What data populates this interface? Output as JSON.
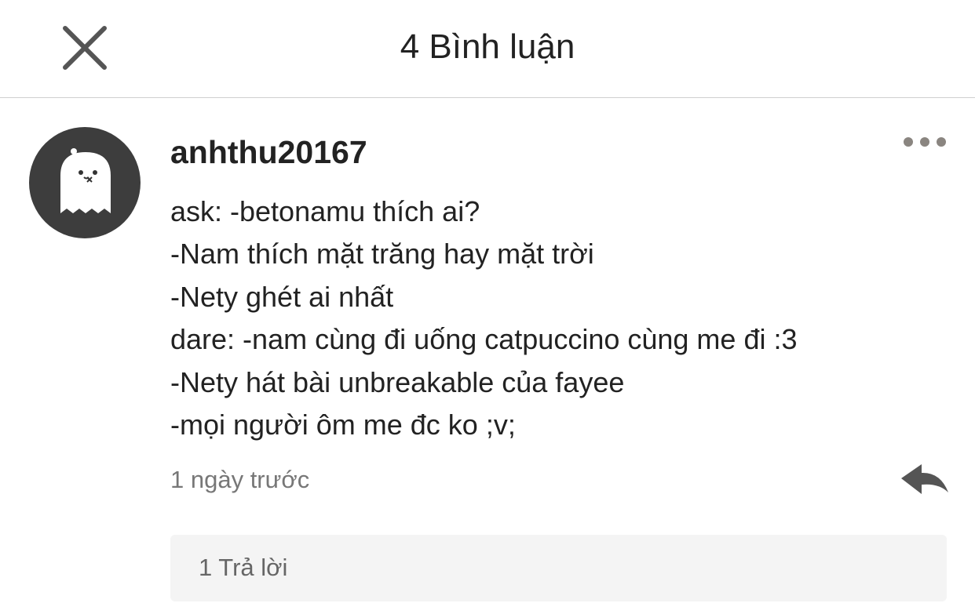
{
  "header": {
    "title": "4 Bình luận",
    "close_icon": "close-icon"
  },
  "comment": {
    "avatar_icon": "ghost-avatar",
    "username": "anhthu20167",
    "more_icon": "more-horizontal-icon",
    "lines": [
      "ask: -betonamu thích ai?",
      "-Nam thích mặt trăng hay mặt trời",
      "-Nety ghét ai nhất",
      "dare: -nam cùng đi uống catpuccino cùng me đi :3",
      "-Nety hát bài unbreakable của fayee",
      "-mọi người ôm me đc ko ;v;"
    ],
    "timestamp": "1 ngày trước",
    "reply_icon": "reply-arrow-icon",
    "replies_label": "1 Trả lời"
  },
  "colors": {
    "text": "#222222",
    "secondary_text": "#777777",
    "divider": "#cfcfcf",
    "reply_box_bg": "#f4f4f4",
    "icon_gray": "#8a8580"
  }
}
